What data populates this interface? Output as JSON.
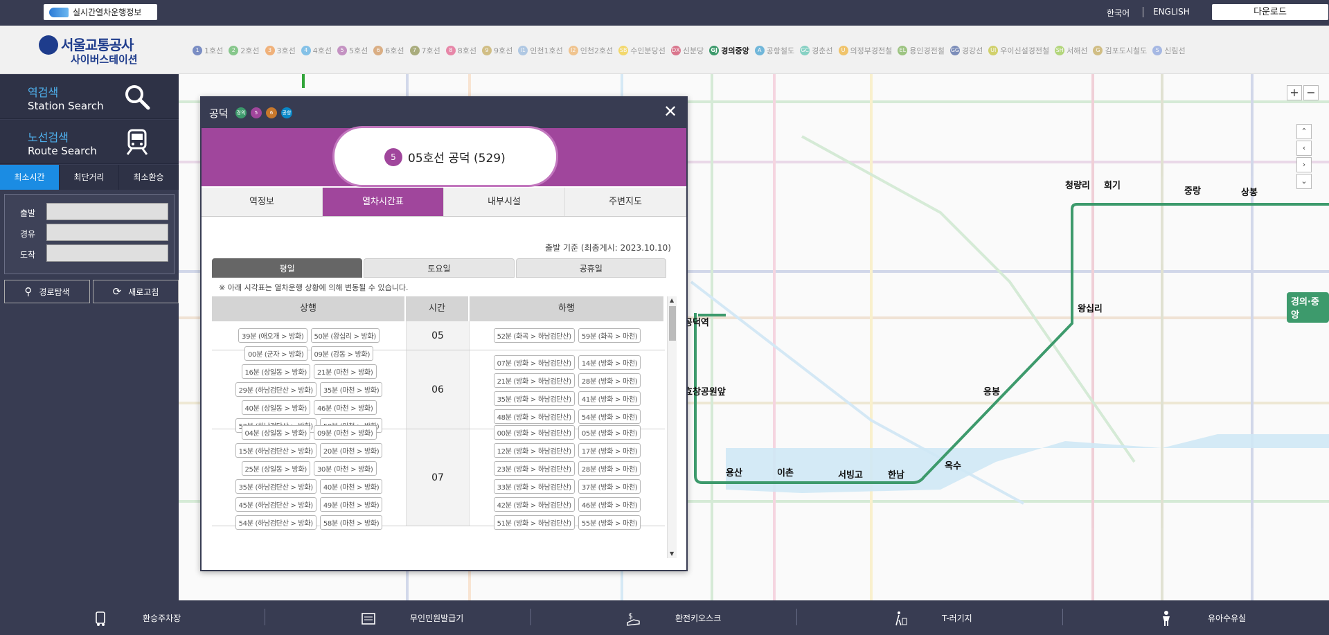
{
  "topbar": {
    "realtime_label": "실시간열차운행정보",
    "lang_ko": "한국어",
    "lang_en": "ENGLISH",
    "download": "다운로드"
  },
  "logo": {
    "line1": "서울교통공사",
    "line2": "사이버스테이션"
  },
  "lines": [
    {
      "label": "1호선",
      "color": "#1b3fa0",
      "n": "1"
    },
    {
      "label": "2호선",
      "color": "#32a53a",
      "n": "2"
    },
    {
      "label": "3호선",
      "color": "#f07d1a",
      "n": "3"
    },
    {
      "label": "4호선",
      "color": "#2c9be0",
      "n": "4"
    },
    {
      "label": "5호선",
      "color": "#a0469c",
      "n": "5"
    },
    {
      "label": "6호선",
      "color": "#c8782c",
      "n": "6"
    },
    {
      "label": "7호선",
      "color": "#6f7520",
      "n": "7"
    },
    {
      "label": "8호선",
      "color": "#e0326e",
      "n": "8"
    },
    {
      "label": "9호선",
      "color": "#b8962e",
      "n": "9"
    },
    {
      "label": "인천1호선",
      "color": "#7ca8d8",
      "n": "I1"
    },
    {
      "label": "인천2호선",
      "color": "#f0a040",
      "n": "I2"
    },
    {
      "label": "수인분당선",
      "color": "#f5c400",
      "n": "SB"
    },
    {
      "label": "신분당",
      "color": "#c8123c",
      "n": "DX"
    },
    {
      "label": "경의중앙",
      "color": "#3d9a6c",
      "n": "GJ",
      "active": true
    },
    {
      "label": "공항철도",
      "color": "#0a88c8",
      "n": "A"
    },
    {
      "label": "경춘선",
      "color": "#32b8a0",
      "n": "GC"
    },
    {
      "label": "의정부경전철",
      "color": "#f0a000",
      "n": "U"
    },
    {
      "label": "용인경전철",
      "color": "#5aa028",
      "n": "EL"
    },
    {
      "label": "경강선",
      "color": "#1e3c8c",
      "n": "GG"
    },
    {
      "label": "우이신설경전철",
      "color": "#b8b800",
      "n": "UI"
    },
    {
      "label": "서해선",
      "color": "#82c01e",
      "n": "SH"
    },
    {
      "label": "김포도시철도",
      "color": "#b8962e",
      "n": "G"
    },
    {
      "label": "신림선",
      "color": "#6a8ad8",
      "n": "S"
    }
  ],
  "sidebar": {
    "station_search_ko": "역검색",
    "station_search_en": "Station Search",
    "route_search_ko": "노선검색",
    "route_search_en": "Route Search",
    "tabs": [
      "최소시간",
      "최단거리",
      "최소환승"
    ],
    "fields": {
      "depart": "출발",
      "via": "경유",
      "arrive": "도착"
    },
    "btn_search": "경로탐색",
    "btn_refresh": "새로고침"
  },
  "popup": {
    "station": "공덕",
    "line_badges": [
      {
        "text": "경의",
        "color": "#3d9a6c"
      },
      {
        "text": "5",
        "color": "#a0469c"
      },
      {
        "text": "6",
        "color": "#c8782c"
      },
      {
        "text": "공항",
        "color": "#0a88c8"
      }
    ],
    "line_num": "5",
    "title": "05호선 공덕 (529)",
    "tabs": [
      "역정보",
      "열차시간표",
      "내부시설",
      "주변지도"
    ],
    "basis": "출발 기준 (최종게시: 2023.10.10)",
    "day_tabs": [
      "평일",
      "토요일",
      "공휴일"
    ],
    "note": "※ 아래 시각표는 열차운행 상황에 의해 변동될 수 있습니다.",
    "col_up": "상행",
    "col_time": "시간",
    "col_down": "하행",
    "rows": [
      {
        "hour": "05",
        "up": [
          "39분 (애오개 > 방화)",
          "50분 (왕십리 > 방화)"
        ],
        "down": [
          "52분 (화곡 > 하남검단산)",
          "59분 (화곡 > 마천)"
        ]
      },
      {
        "hour": "06",
        "up": [
          "00분 (군자 > 방화)",
          "09분 (강동 > 방화)",
          "16분 (상일동 > 방화)",
          "21분 (마천 > 방화)",
          "29분 (하남검단산 > 방화)",
          "35분 (마천 > 방화)",
          "40분 (상일동 > 방화)",
          "46분 (마천 > 방화)",
          "52분 (하남검단산 > 방화)",
          "58분 (마천 > 방화)"
        ],
        "down": [
          "07분 (방화 > 하남검단산)",
          "14분 (방화 > 마천)",
          "21분 (방화 > 하남검단산)",
          "28분 (방화 > 마천)",
          "35분 (방화 > 하남검단산)",
          "41분 (방화 > 마천)",
          "48분 (방화 > 하남검단산)",
          "54분 (방화 > 마천)"
        ]
      },
      {
        "hour": "07",
        "up": [
          "04분 (상일동 > 방화)",
          "09분 (마천 > 방화)",
          "15분 (하남검단산 > 방화)",
          "20분 (마천 > 방화)",
          "25분 (상일동 > 방화)",
          "30분 (마천 > 방화)",
          "35분 (하남검단산 > 방화)",
          "40분 (마천 > 방화)",
          "45분 (하남검단산 > 방화)",
          "49분 (마천 > 방화)",
          "54분 (하남검단산 > 방화)",
          "58분 (마천 > 방화)"
        ],
        "down": [
          "00분 (방화 > 하남검단산)",
          "05분 (방화 > 마천)",
          "12분 (방화 > 하남검단산)",
          "17분 (방화 > 마천)",
          "23분 (방화 > 하남검단산)",
          "28분 (방화 > 마천)",
          "33분 (방화 > 하남검단산)",
          "37분 (방화 > 마천)",
          "42분 (방화 > 하남검단산)",
          "46분 (방화 > 마천)",
          "51분 (방화 > 하남검단산)",
          "55분 (방화 > 마천)"
        ]
      }
    ]
  },
  "map": {
    "stations": [
      "청량리",
      "회기",
      "중랑",
      "상봉",
      "왕십리",
      "응봉",
      "옥수",
      "한남",
      "서빙고",
      "이촌",
      "용산",
      "효창공원앞",
      "공덕역"
    ],
    "line_badge": "경의·중앙",
    "zoom_in": "+",
    "zoom_out": "−"
  },
  "bottom": [
    "환승주차장",
    "무인민원발급기",
    "환전키오스크",
    "T-러기지",
    "유아수유실"
  ]
}
